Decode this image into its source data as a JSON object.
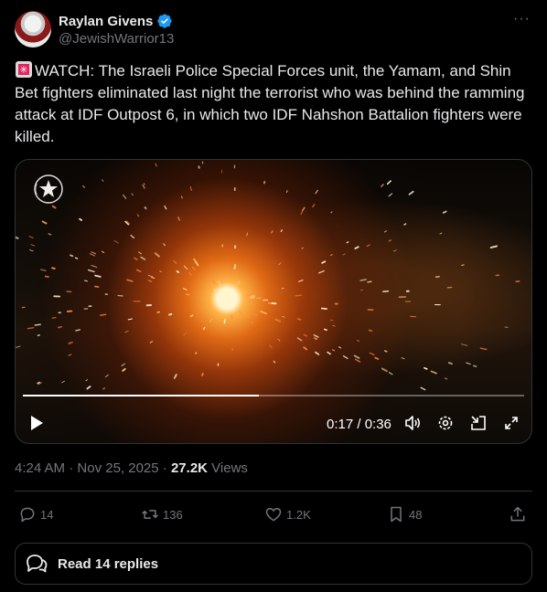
{
  "author": {
    "name": "Raylan Givens",
    "handle": "@JewishWarrior13"
  },
  "post": {
    "text": "WATCH:  The Israeli Police Special Forces unit, the Yamam, and Shin Bet fighters eliminated last night the terrorist who was behind the ramming attack at IDF Outpost 6, in which two IDF Nahshon Battalion fighters were killed."
  },
  "video": {
    "time_display": "0:17 / 0:36",
    "progress": 0.47
  },
  "meta": {
    "time": "4:24 AM",
    "sep1": " · ",
    "date": "Nov 25, 2025",
    "sep2": " · ",
    "views_count": "27.2K",
    "views_label": " Views"
  },
  "actions": {
    "replies": "14",
    "reposts": "136",
    "likes": "1.2K",
    "bookmarks": "48"
  },
  "read_replies_label": "Read 14 replies",
  "colors": {
    "background": "#000000",
    "text": "#e7e9ea",
    "muted": "#71767b",
    "border": "#2f3336",
    "verified": "#1d9bf0"
  }
}
